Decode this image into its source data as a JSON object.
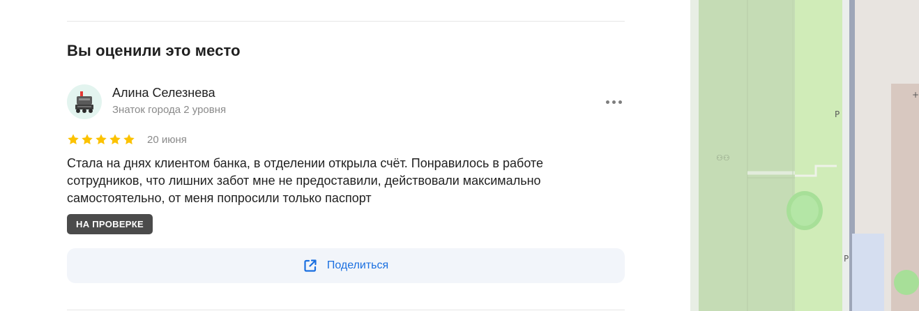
{
  "section": {
    "title": "Вы оценили это место"
  },
  "review": {
    "author_name": "Алина Селезнева",
    "author_level": "Знаток города 2 уровня",
    "rating": 5,
    "rating_max": 5,
    "date": "20 июня",
    "text": "Стала на днях клиентом банка, в отделении открыла счёт. Понравилось в работе сотрудников, что лишних забот мне не предоставили, действовали максимально самостоятельно, от меня попросили только паспорт",
    "status_badge": "НА ПРОВЕРКЕ",
    "share_label": "Поделиться"
  },
  "icons": {
    "avatar": "robot-avatar",
    "more": "more-dots-icon",
    "star": "star-icon",
    "share": "share-icon"
  },
  "colors": {
    "star": "#fcc200",
    "accent": "#1a6fe0",
    "badge_bg": "#4b4b4b",
    "map_green": "#c5dcb5"
  },
  "map": {
    "labels": {
      "parking_1": "P",
      "parking_2": "P"
    }
  }
}
